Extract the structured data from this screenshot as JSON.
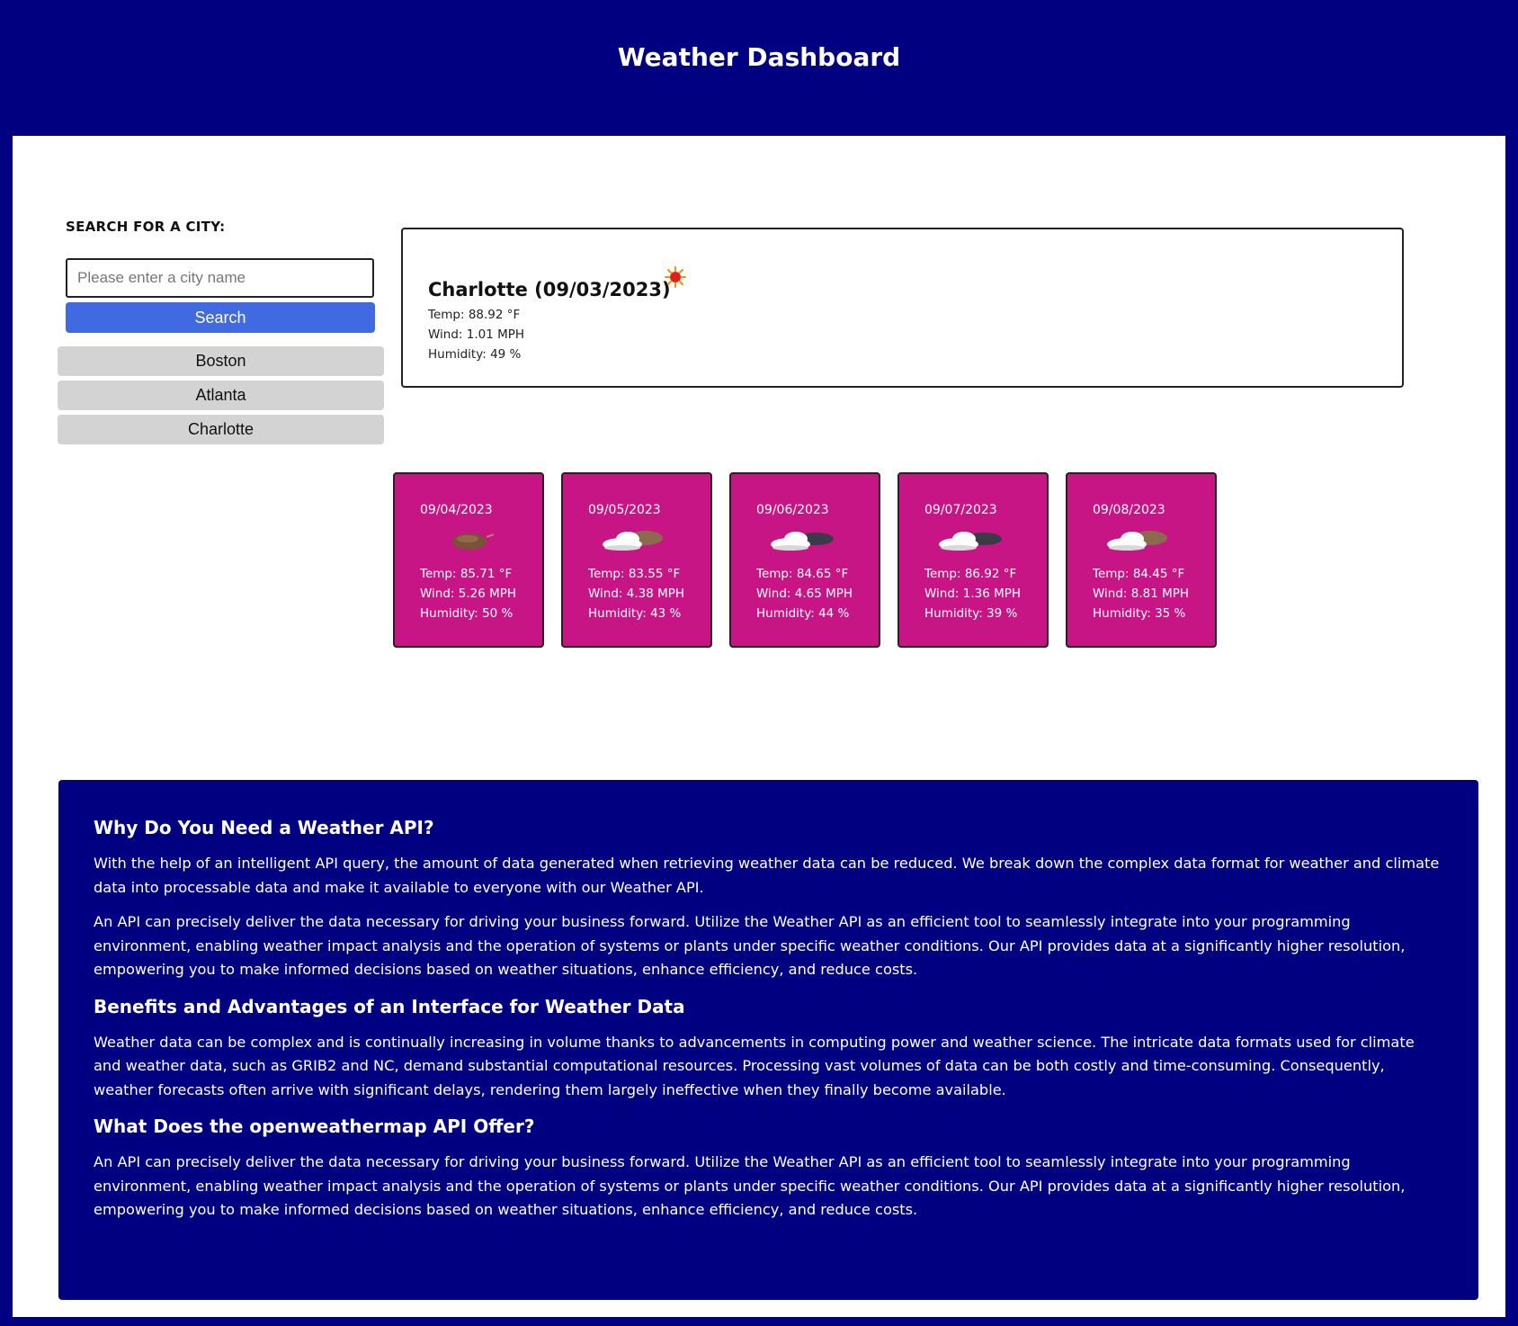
{
  "header": {
    "title": "Weather Dashboard"
  },
  "search": {
    "label": "SEARCH FOR A CITY:",
    "placeholder": "Please enter a city name",
    "button_label": "Search"
  },
  "history": [
    "Boston",
    "Atlanta",
    "Charlotte"
  ],
  "current": {
    "title": "Charlotte (09/03/2023)",
    "icon": "sun-icon",
    "temp": "Temp: 88.92 °F",
    "wind": "Wind: 1.01 MPH",
    "humidity": "Humidity: 49 %"
  },
  "forecast": [
    {
      "date": "09/04/2023",
      "icon": "rain-cloud-icon",
      "temp": "Temp: 85.71 °F",
      "wind": "Wind: 5.26 MPH",
      "humidity": "Humidity: 50 %"
    },
    {
      "date": "09/05/2023",
      "icon": "broken-clouds-icon",
      "temp": "Temp: 83.55 °F",
      "wind": "Wind: 4.38 MPH",
      "humidity": "Humidity: 43 %"
    },
    {
      "date": "09/06/2023",
      "icon": "overcast-clouds-icon",
      "temp": "Temp: 84.65 °F",
      "wind": "Wind: 4.65 MPH",
      "humidity": "Humidity: 44 %"
    },
    {
      "date": "09/07/2023",
      "icon": "overcast-clouds-icon",
      "temp": "Temp: 86.92 °F",
      "wind": "Wind: 1.36 MPH",
      "humidity": "Humidity: 39 %"
    },
    {
      "date": "09/08/2023",
      "icon": "broken-clouds-icon",
      "temp": "Temp: 84.45 °F",
      "wind": "Wind: 8.81 MPH",
      "humidity": "Humidity: 35 %"
    }
  ],
  "info": {
    "heading1": "Why Do You Need a Weather API?",
    "para1": "With the help of an intelligent API query, the amount of data generated when retrieving weather data can be reduced. We break down the complex data format for weather and climate data into processable data and make it available to everyone with our Weather API.",
    "para2": "An API can precisely deliver the data necessary for driving your business forward. Utilize the Weather API as an efficient tool to seamlessly integrate into your programming environment, enabling weather impact analysis and the operation of systems or plants under specific weather conditions. Our API provides data at a significantly higher resolution, empowering you to make informed decisions based on weather situations, enhance efficiency, and reduce costs.",
    "heading2": "Benefits and Advantages of an Interface for Weather Data",
    "para3": "Weather data can be complex and is continually increasing in volume thanks to advancements in computing power and weather science. The intricate data formats used for climate and weather data, such as GRIB2 and NC, demand substantial computational resources. Processing vast volumes of data can be both costly and time-consuming. Consequently, weather forecasts often arrive with significant delays, rendering them largely ineffective when they finally become available.",
    "heading3": "What Does the openweathermap API Offer?",
    "para4": "An API can precisely deliver the data necessary for driving your business forward. Utilize the Weather API as an efficient tool to seamlessly integrate into your programming environment, enabling weather impact analysis and the operation of systems or plants under specific weather conditions. Our API provides data at a significantly higher resolution, empowering you to make informed decisions based on weather situations, enhance efficiency, and reduce costs."
  }
}
